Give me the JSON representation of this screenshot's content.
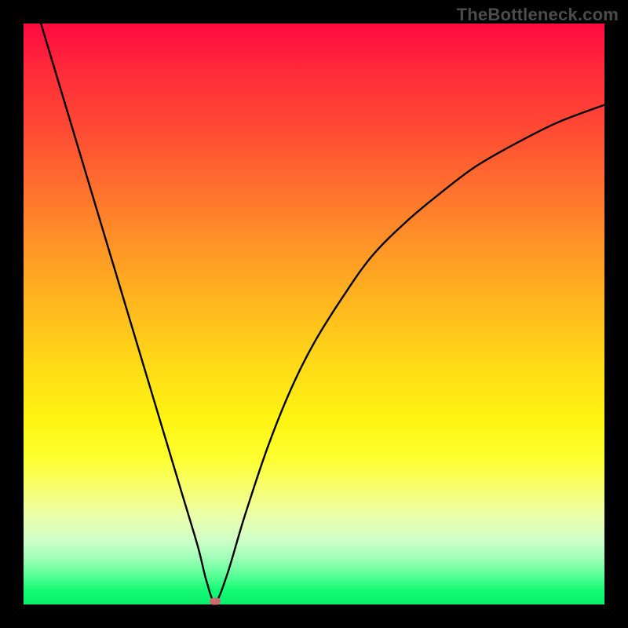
{
  "watermark": "TheBottleneck.com",
  "colors": {
    "frame_bg": "#000000",
    "curve": "#000000",
    "marker": "#cc6b70",
    "gradient_top": "#ff0b3f",
    "gradient_bottom": "#09f06d"
  },
  "chart_data": {
    "type": "line",
    "title": "",
    "xlabel": "",
    "ylabel": "",
    "xlim": [
      0,
      100
    ],
    "ylim": [
      0,
      100
    ],
    "grid": false,
    "series": [
      {
        "name": "bottleneck-curve",
        "x": [
          3,
          6,
          9,
          12,
          15,
          18,
          21,
          24,
          27,
          30,
          31.5,
          33,
          35,
          38,
          42,
          46,
          50,
          55,
          60,
          66,
          72,
          78,
          85,
          92,
          100
        ],
        "y": [
          100,
          90,
          80,
          70,
          60,
          50,
          40,
          30,
          20,
          10,
          4,
          0.5,
          5,
          15,
          27,
          37,
          45,
          53,
          60,
          66,
          71,
          75.5,
          79.5,
          83,
          86
        ]
      }
    ],
    "marker": {
      "x": 33,
      "y": 0.5
    },
    "note": "x and y are percentages of the plot area; values estimated from pixels."
  }
}
